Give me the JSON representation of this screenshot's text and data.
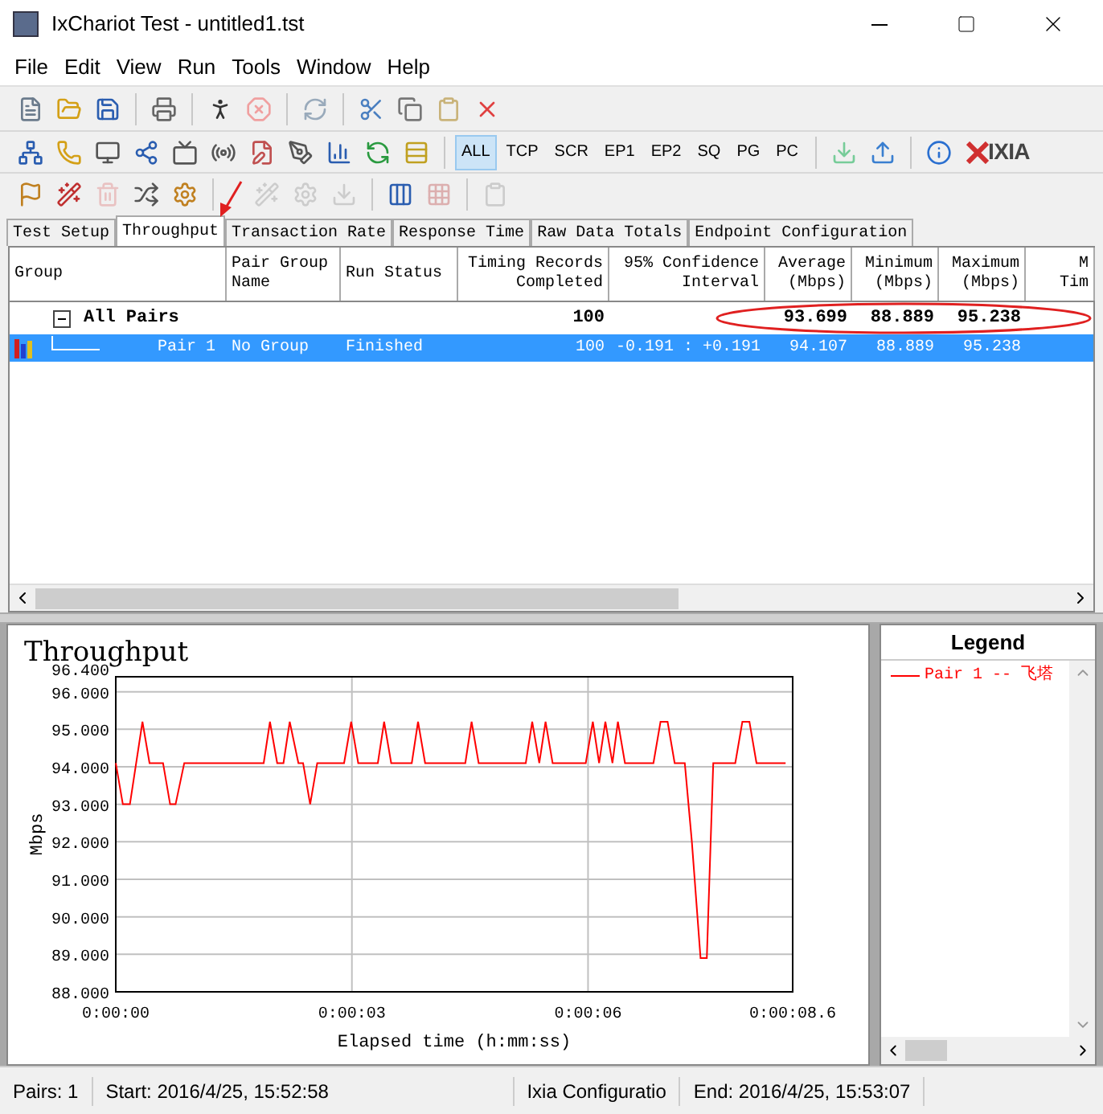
{
  "window": {
    "title": "IxChariot Test - untitled1.tst"
  },
  "menu": [
    "File",
    "Edit",
    "View",
    "Run",
    "Tools",
    "Window",
    "Help"
  ],
  "filter_buttons": [
    {
      "label": "ALL",
      "selected": true
    },
    {
      "label": "TCP",
      "selected": false
    },
    {
      "label": "SCR",
      "selected": false
    },
    {
      "label": "EP1",
      "selected": false
    },
    {
      "label": "EP2",
      "selected": false
    },
    {
      "label": "SQ",
      "selected": false
    },
    {
      "label": "PG",
      "selected": false
    },
    {
      "label": "PC",
      "selected": false
    }
  ],
  "logo": "IXIA",
  "tabs": [
    {
      "label": "Test Setup",
      "selected": false
    },
    {
      "label": "Throughput",
      "selected": true
    },
    {
      "label": "Transaction Rate",
      "selected": false
    },
    {
      "label": "Response Time",
      "selected": false
    },
    {
      "label": "Raw Data Totals",
      "selected": false
    },
    {
      "label": "Endpoint Configuration",
      "selected": false
    }
  ],
  "table": {
    "columns": [
      {
        "lines": [
          "Group"
        ]
      },
      {
        "lines": [
          "Pair Group",
          "Name"
        ]
      },
      {
        "lines": [
          "Run Status"
        ]
      },
      {
        "lines": [
          "Timing Records",
          "Completed"
        ]
      },
      {
        "lines": [
          "95% Confidence",
          "Interval"
        ]
      },
      {
        "lines": [
          "Average",
          "(Mbps)"
        ]
      },
      {
        "lines": [
          "Minimum",
          "(Mbps)"
        ]
      },
      {
        "lines": [
          "Maximum",
          "(Mbps)"
        ]
      },
      {
        "lines": [
          "M",
          "Tim"
        ]
      }
    ],
    "rows": [
      {
        "kind": "group",
        "expanded": true,
        "selected": false,
        "cells": [
          "All Pairs",
          "",
          "",
          "100",
          "",
          "93.699",
          "88.889",
          "95.238"
        ]
      },
      {
        "kind": "pair",
        "selected": true,
        "cells": [
          "Pair 1",
          "No Group",
          "Finished",
          "100",
          "-0.191 : +0.191",
          "94.107",
          "88.889",
          "95.238"
        ]
      }
    ]
  },
  "chart": {
    "chart_data": {
      "type": "line",
      "title": "Throughput",
      "xlabel": "Elapsed time (h:mm:ss)",
      "ylabel": "Mbps",
      "xlim": [
        0,
        8.6
      ],
      "ylim": [
        88,
        96.4
      ],
      "xticks": [
        {
          "value": 0,
          "label": "0:00:00"
        },
        {
          "value": 3,
          "label": "0:00:03"
        },
        {
          "value": 6,
          "label": "0:00:06"
        },
        {
          "value": 8.6,
          "label": "0:00:08.6"
        }
      ],
      "yticks": [
        {
          "value": 88,
          "label": "88.000"
        },
        {
          "value": 89,
          "label": "89.000"
        },
        {
          "value": 90,
          "label": "90.000"
        },
        {
          "value": 91,
          "label": "91.000"
        },
        {
          "value": 92,
          "label": "92.000"
        },
        {
          "value": 93,
          "label": "93.000"
        },
        {
          "value": 94,
          "label": "94.000"
        },
        {
          "value": 95,
          "label": "95.000"
        },
        {
          "value": 96,
          "label": "96.000"
        },
        {
          "value": 96.4,
          "label": "96.400"
        }
      ],
      "x": [
        0,
        0.09,
        0.18,
        0.34,
        0.43,
        0.6,
        0.69,
        0.76,
        0.87,
        1.88,
        1.96,
        2.05,
        2.13,
        2.21,
        2.32,
        2.38,
        2.47,
        2.56,
        2.9,
        2.99,
        3.08,
        3.33,
        3.41,
        3.5,
        3.76,
        3.84,
        3.93,
        4.44,
        4.52,
        4.61,
        5.21,
        5.29,
        5.38,
        5.46,
        5.55,
        5.97,
        6.06,
        6.14,
        6.22,
        6.31,
        6.38,
        6.47,
        6.83,
        6.92,
        7.01,
        7.1,
        7.23,
        7.32,
        7.43,
        7.51,
        7.59,
        7.87,
        7.96,
        8.05,
        8.14,
        8.51
      ],
      "grid": true,
      "series": [
        {
          "color": "#ff0000",
          "values": [
            94.1,
            93.0,
            93.0,
            95.2,
            94.1,
            94.1,
            93.0,
            93.0,
            94.1,
            94.1,
            95.2,
            94.1,
            94.1,
            95.2,
            94.1,
            94.1,
            93.0,
            94.1,
            94.1,
            95.2,
            94.1,
            94.1,
            95.2,
            94.1,
            94.1,
            95.2,
            94.1,
            94.1,
            95.2,
            94.1,
            94.1,
            95.2,
            94.1,
            95.2,
            94.1,
            94.1,
            95.2,
            94.1,
            95.2,
            94.1,
            95.2,
            94.1,
            94.1,
            95.2,
            95.2,
            94.1,
            94.1,
            92.0,
            88.9,
            88.9,
            94.1,
            94.1,
            95.2,
            95.2,
            94.1,
            94.1
          ]
        }
      ]
    }
  },
  "legend": {
    "title": "Legend",
    "items": [
      {
        "label": "Pair 1 -- 飞塔",
        "color": "#ff0000"
      }
    ]
  },
  "status_bar": [
    "Pairs: 1",
    "Start: 2016/4/25, 15:52:58",
    "Ixia Configuratio",
    "End: 2016/4/25, 15:53:07"
  ]
}
